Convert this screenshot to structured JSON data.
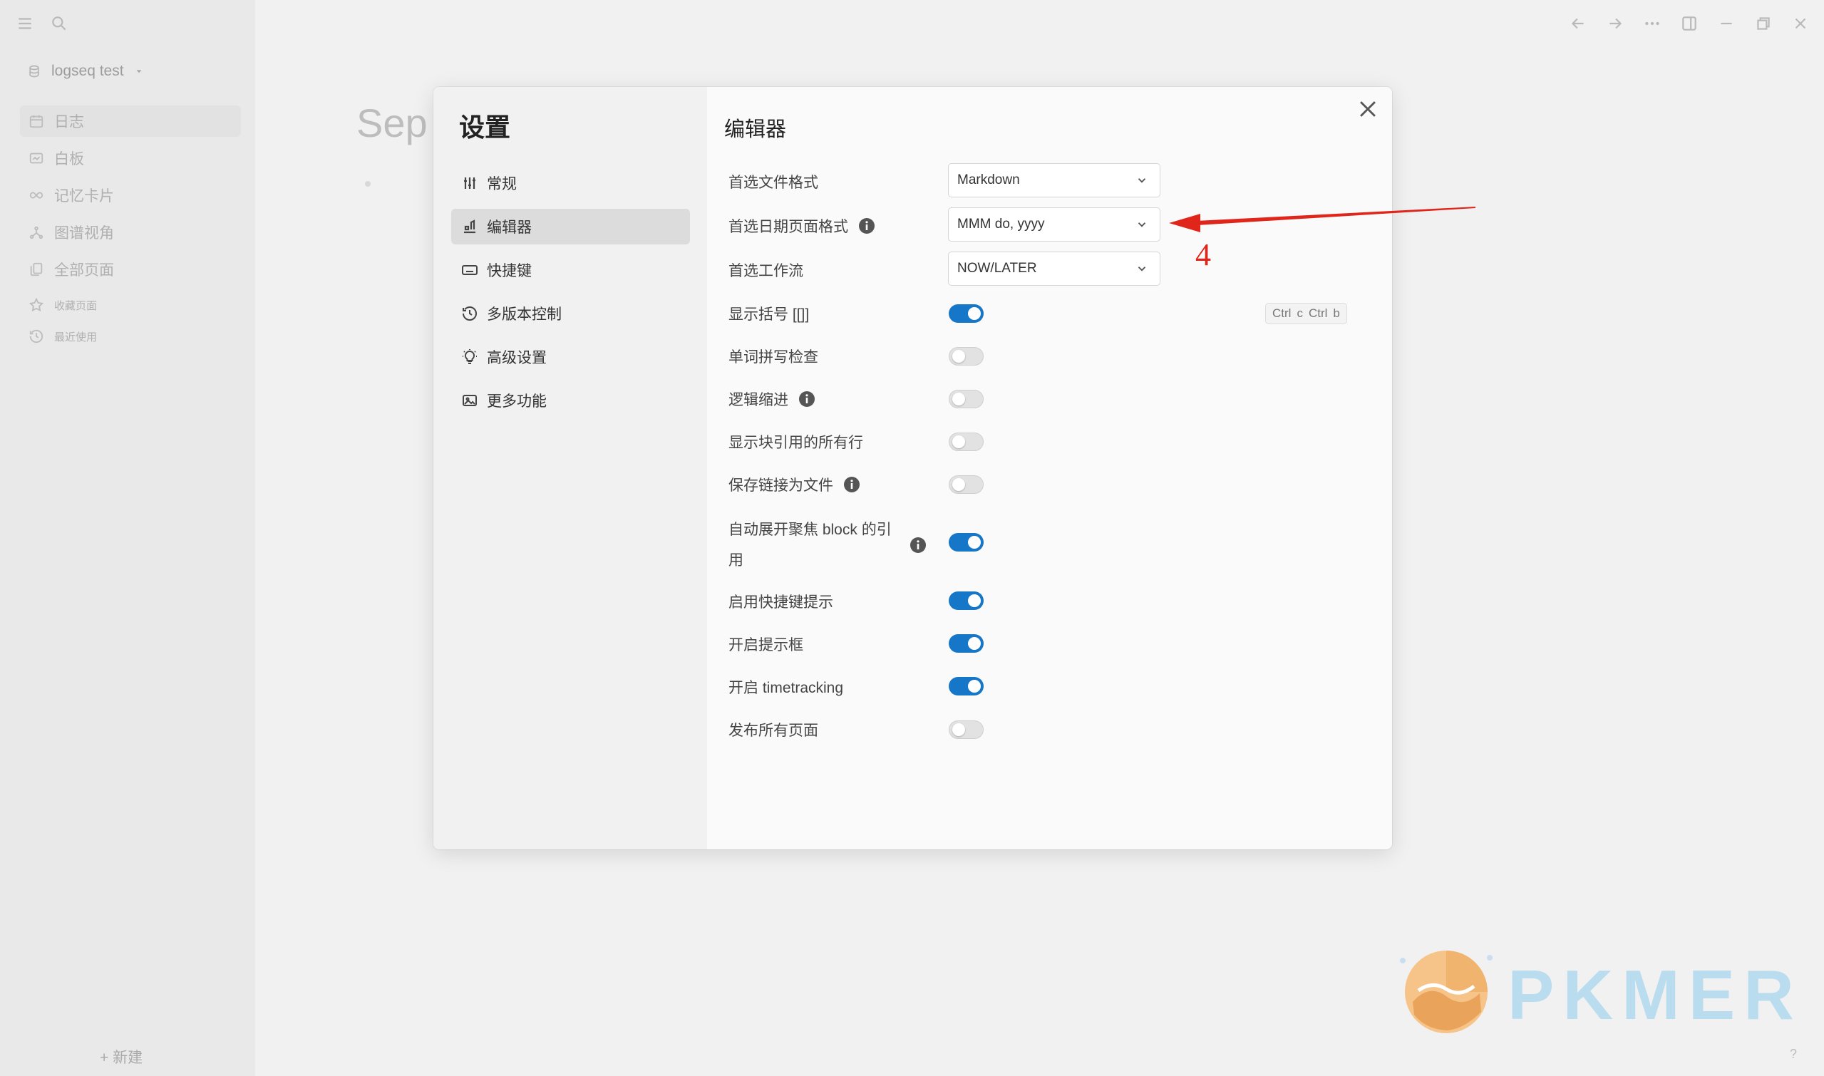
{
  "app": {
    "graph_name": "logseq test",
    "nav": [
      {
        "label": "日志",
        "icon": "calendar-icon"
      },
      {
        "label": "白板",
        "icon": "whiteboard-icon"
      },
      {
        "label": "记忆卡片",
        "icon": "infinity-icon"
      },
      {
        "label": "图谱视角",
        "icon": "graph-icon"
      },
      {
        "label": "全部页面",
        "icon": "pages-icon"
      }
    ],
    "favorites_label": "收藏页面",
    "recent_label": "最近使用",
    "new_page_label": "+ 新建",
    "background_title": "Sep",
    "help_label": "?"
  },
  "settings": {
    "title": "设置",
    "menu": [
      {
        "label": "常规",
        "icon": "sliders-icon",
        "active": false
      },
      {
        "label": "编辑器",
        "icon": "editor-icon",
        "active": true
      },
      {
        "label": "快捷键",
        "icon": "keyboard-icon",
        "active": false
      },
      {
        "label": "多版本控制",
        "icon": "history-icon",
        "active": false
      },
      {
        "label": "高级设置",
        "icon": "bulb-icon",
        "active": false
      },
      {
        "label": "更多功能",
        "icon": "image-icon",
        "active": false
      }
    ],
    "section_title": "编辑器",
    "rows": [
      {
        "label": "首选文件格式",
        "type": "select",
        "value": "Markdown",
        "info": false
      },
      {
        "label": "首选日期页面格式",
        "type": "select",
        "value": "MMM do, yyyy",
        "info": true
      },
      {
        "label": "首选工作流",
        "type": "select",
        "value": "NOW/LATER",
        "info": false
      },
      {
        "label": "显示括号 [[]]",
        "type": "toggle",
        "value": true,
        "info": false,
        "shortcut": [
          "Ctrl",
          "c",
          "Ctrl",
          "b"
        ]
      },
      {
        "label": "单词拼写检查",
        "type": "toggle",
        "value": false,
        "info": false
      },
      {
        "label": "逻辑缩进",
        "type": "toggle",
        "value": false,
        "info": true
      },
      {
        "label": "显示块引用的所有行",
        "type": "toggle",
        "value": false,
        "info": false
      },
      {
        "label": "保存链接为文件",
        "type": "toggle",
        "value": false,
        "info": true
      },
      {
        "label": "自动展开聚焦 block 的引用",
        "type": "toggle",
        "value": true,
        "info": true
      },
      {
        "label": "启用快捷键提示",
        "type": "toggle",
        "value": true,
        "info": false
      },
      {
        "label": "开启提示框",
        "type": "toggle",
        "value": true,
        "info": false
      },
      {
        "label": "开启 timetracking",
        "type": "toggle",
        "value": true,
        "info": false
      },
      {
        "label": "发布所有页面",
        "type": "toggle",
        "value": false,
        "info": false
      }
    ]
  },
  "annotation": {
    "number": "4",
    "color": "#e0261b"
  },
  "watermark": {
    "text": "PKMER"
  },
  "colors": {
    "toggle_on": "#1676c8",
    "accent_annotation": "#e0261b"
  }
}
